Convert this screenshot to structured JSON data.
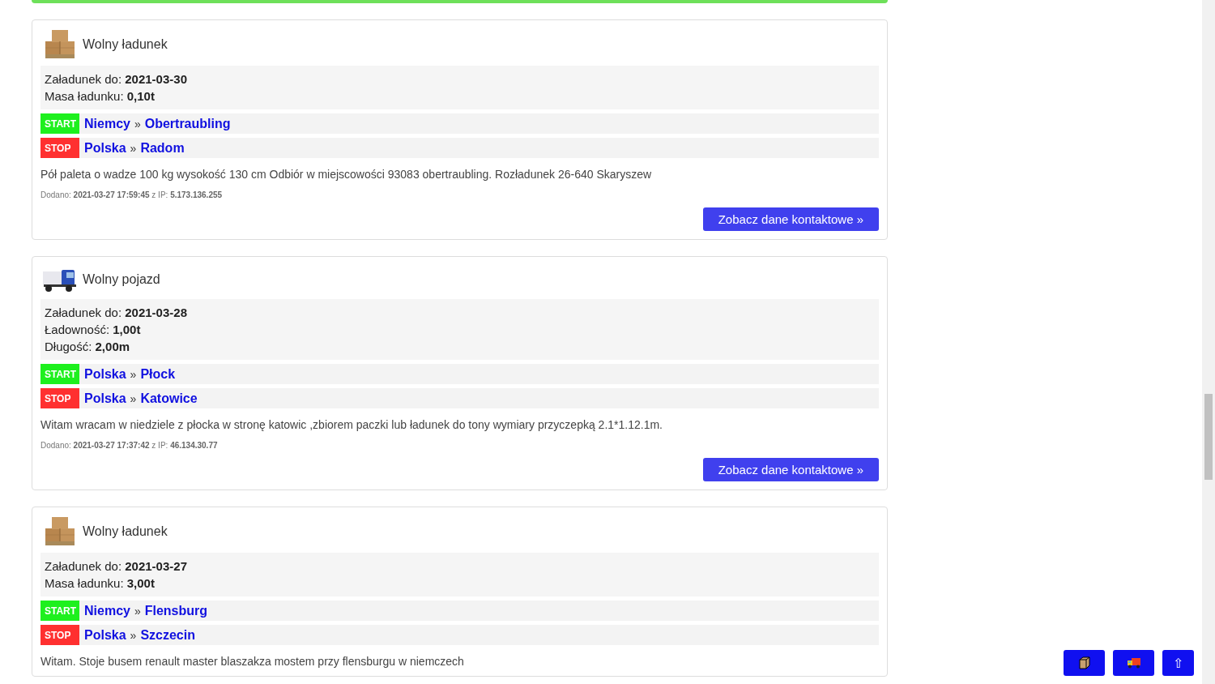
{
  "cards": [
    {
      "kind": "cargo",
      "title": "Wolny ładunek",
      "details": [
        "Załadunek do: **2021-03-30**",
        "Masa ładunku: **0,10t**"
      ],
      "start": {
        "label": "START",
        "country": "Niemcy",
        "separator": "»",
        "city": "Obertraubling"
      },
      "stop": {
        "label": "STOP",
        "country": "Polska",
        "separator": "»",
        "city": "Radom"
      },
      "description": "Pół paleta o wadze 100 kg wysokość 130 cm Odbiór w miejscowości 93083 obertraubling. Rozładunek 26-640 Skaryszew",
      "added": "Dodano: **2021-03-27 17:59:45** z IP: **5.173.136.255**",
      "button": "Zobacz dane kontaktowe »"
    },
    {
      "kind": "vehicle",
      "title": "Wolny pojazd",
      "details": [
        "Załadunek do: **2021-03-28**",
        "Ładowność: **1,00t**",
        "Długość: **2,00m**"
      ],
      "start": {
        "label": "START",
        "country": "Polska",
        "separator": "»",
        "city": "Płock"
      },
      "stop": {
        "label": "STOP",
        "country": "Polska",
        "separator": "»",
        "city": "Katowice"
      },
      "description": "Witam wracam w niedziele z płocka w stronę katowic ,zbiorem paczki lub ładunek do tony wymiary przyczepką 2.1*1.12.1m.",
      "added": "Dodano: **2021-03-27 17:37:42** z IP: **46.134.30.77**",
      "button": "Zobacz dane kontaktowe »"
    },
    {
      "kind": "cargo",
      "title": "Wolny ładunek",
      "details": [
        "Załadunek do: **2021-03-27**",
        "Masa ładunku: **3,00t**"
      ],
      "start": {
        "label": "START",
        "country": "Niemcy",
        "separator": "»",
        "city": "Flensburg"
      },
      "stop": {
        "label": "STOP",
        "country": "Polska",
        "separator": "»",
        "city": "Szczecin"
      },
      "description": "Witam. Stoje busem renault master blaszakza mostem przy flensburgu w niemczech"
    }
  ],
  "floating_buttons": [
    {
      "kind": "cargo"
    },
    {
      "kind": "vehicle"
    },
    {
      "kind": "top",
      "label": "⇧"
    }
  ]
}
